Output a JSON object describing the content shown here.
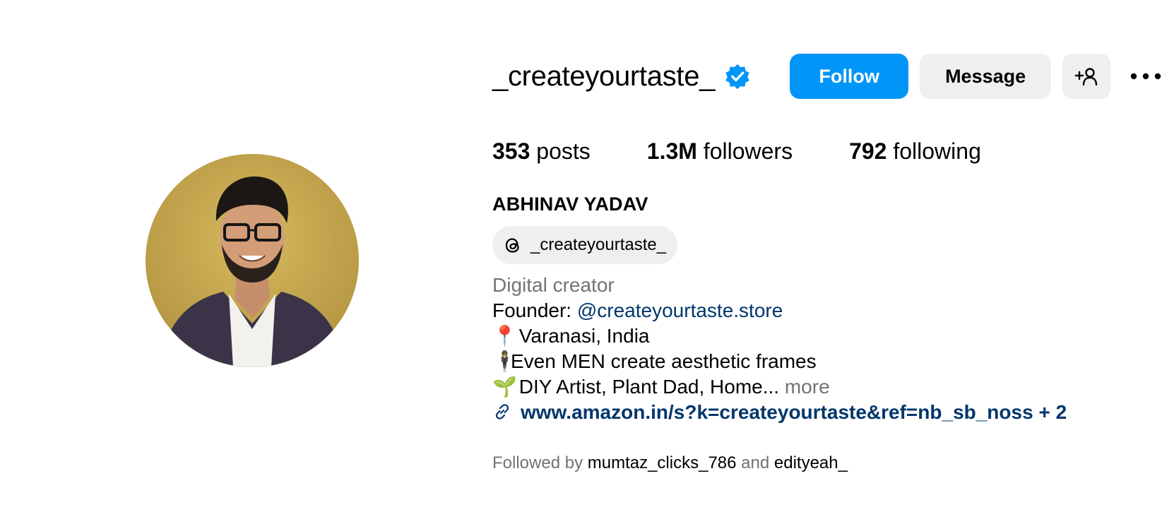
{
  "profile": {
    "username": "_createyourtaste_",
    "verified": true,
    "full_name": "ABHINAV YADAV",
    "threads_handle": "_createyourtaste_"
  },
  "actions": {
    "follow_label": "Follow",
    "message_label": "Message",
    "add_user_icon": "person-plus-icon",
    "more_icon": "ellipsis-icon"
  },
  "stats": {
    "posts_count": "353",
    "posts_label": "posts",
    "followers_count": "1.3M",
    "followers_label": "followers",
    "following_count": "792",
    "following_label": "following"
  },
  "bio": {
    "category": "Digital creator",
    "founder_prefix": "Founder: ",
    "founder_mention": "@createyourtaste.store",
    "location_emoji": "📍",
    "location": " Varanasi, India",
    "line3_emoji": "🕴",
    "line3": "Even MEN create aesthetic frames",
    "line4_emoji": "🌱",
    "line4": " DIY Artist, Plant Dad, Home...",
    "more_label": " more",
    "link": "www.amazon.in/s?k=createyourtaste&ref=nb_sb_noss + 2"
  },
  "followed_by": {
    "prefix": "Followed by ",
    "user1": "mumtaz_clicks_786",
    "conjunction": " and ",
    "user2": "edityeah_"
  },
  "colors": {
    "accent": "#0095f6",
    "link": "#00376b",
    "secondary_text": "#737373",
    "button_bg": "#efefef"
  }
}
